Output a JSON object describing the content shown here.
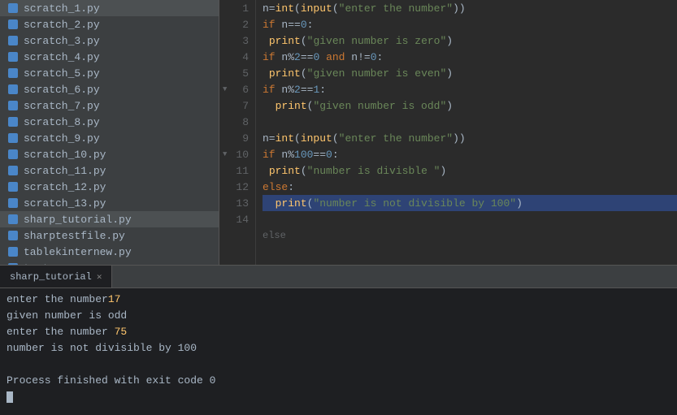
{
  "sidebar": {
    "files": [
      "scratch_1.py",
      "scratch_2.py",
      "scratch_3.py",
      "scratch_4.py",
      "scratch_5.py",
      "scratch_6.py",
      "scratch_7.py",
      "scratch_8.py",
      "scratch_9.py",
      "scratch_10.py",
      "scratch_11.py",
      "scratch_12.py",
      "scratch_13.py",
      "sharp_tutorial.py",
      "sharptestfile.py",
      "tablekintrnew.py",
      "test.py"
    ],
    "selected": "sharp_tutorial.py"
  },
  "editor": {
    "lines": [
      {
        "num": 1,
        "code": "n=int(input(\"enter the number\"))"
      },
      {
        "num": 2,
        "code": "if n==0:"
      },
      {
        "num": 3,
        "code": " print(\"given number is zero\")"
      },
      {
        "num": 4,
        "code": "if n%2==0 and n!=0:"
      },
      {
        "num": 5,
        "code": " print(\"given number is even\")"
      },
      {
        "num": 6,
        "code": "if n%2==1:"
      },
      {
        "num": 7,
        "code": "  print(\"given number is odd\")"
      },
      {
        "num": 8,
        "code": ""
      },
      {
        "num": 9,
        "code": "n=int(input(\"enter the number\"))"
      },
      {
        "num": 10,
        "code": "if n%100==0:"
      },
      {
        "num": 11,
        "code": " print(\"number is divisble \")"
      },
      {
        "num": 12,
        "code": "else:"
      },
      {
        "num": 13,
        "code": "  print(\"number is not divisible by 100\")"
      },
      {
        "num": 14,
        "code": ""
      }
    ]
  },
  "terminal": {
    "tab_label": "sharp_tutorial",
    "output": [
      "enter the number17",
      "given number is odd",
      "enter the number 75",
      "number is not divisible by 100",
      "",
      "Process finished with exit code 0"
    ]
  },
  "icons": {
    "py_file": "🐍"
  }
}
